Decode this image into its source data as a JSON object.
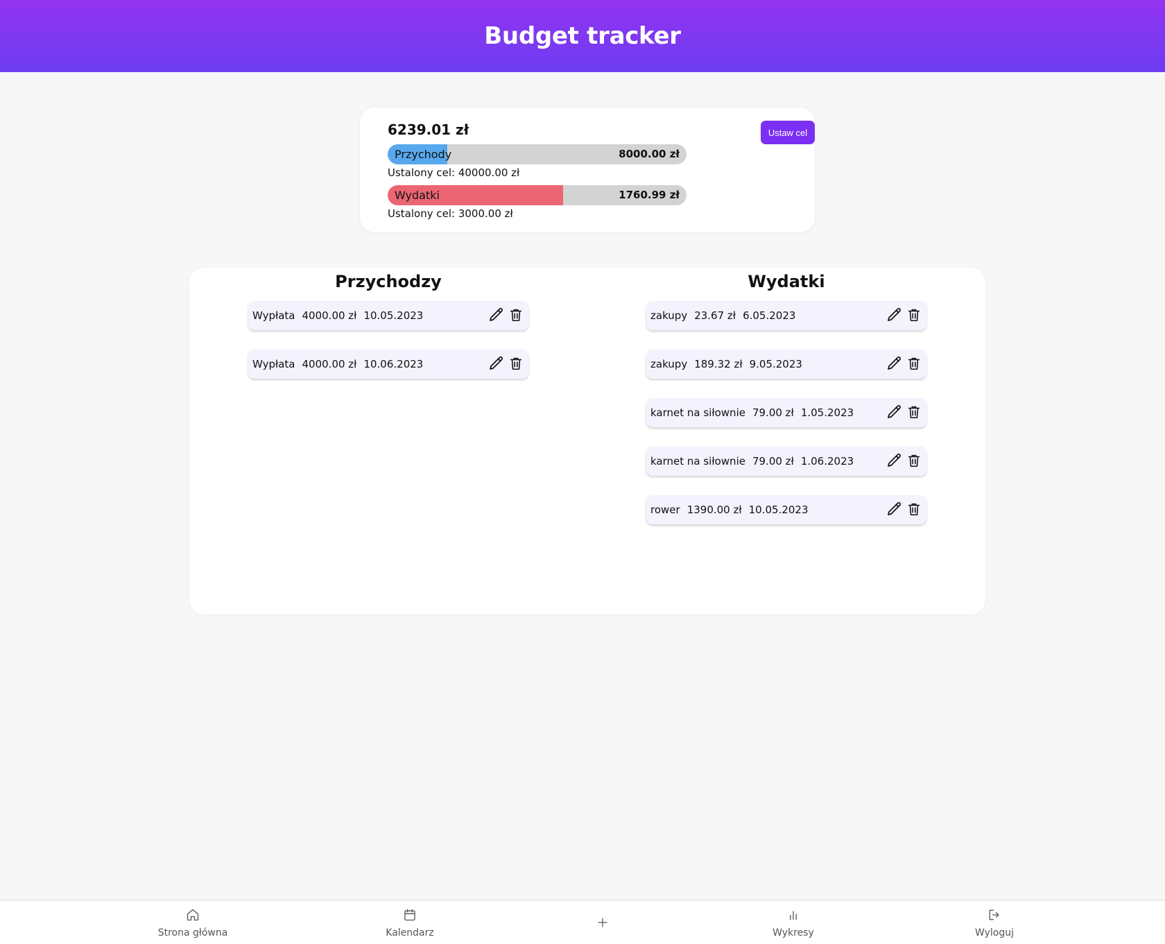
{
  "header": {
    "title": "Budget tracker"
  },
  "summary": {
    "balance": "6239.01 zł",
    "goal_button": "Ustaw cel",
    "income": {
      "label": "Przychody",
      "amount": "8000.00 zł",
      "goal": "Ustalony cel: 40000.00 zł",
      "progress_percent": 20,
      "color": "#58a8ee"
    },
    "expenses": {
      "label": "Wydatki",
      "amount": "1760.99 zł",
      "goal": "Ustalony cel: 3000.00 zł",
      "progress_percent": 58.7,
      "color": "#eb6672"
    }
  },
  "income_list": {
    "title": "Przychodzy",
    "items": [
      {
        "name": "Wypłata",
        "amount": "4000.00 zł",
        "date": "10.05.2023"
      },
      {
        "name": "Wypłata",
        "amount": "4000.00 zł",
        "date": "10.06.2023"
      }
    ]
  },
  "expense_list": {
    "title": "Wydatki",
    "items": [
      {
        "name": "zakupy",
        "amount": "23.67 zł",
        "date": "6.05.2023"
      },
      {
        "name": "zakupy",
        "amount": "189.32 zł",
        "date": "9.05.2023"
      },
      {
        "name": "karnet na siłownie",
        "amount": "79.00 zł",
        "date": "1.05.2023"
      },
      {
        "name": "karnet na siłownie",
        "amount": "79.00 zł",
        "date": "1.06.2023"
      },
      {
        "name": "rower",
        "amount": "1390.00 zł",
        "date": "10.05.2023"
      }
    ]
  },
  "navbar": {
    "items": [
      {
        "label": "Strona główna",
        "icon": "home-icon"
      },
      {
        "label": "Kalendarz",
        "icon": "calendar-icon"
      },
      {
        "label": "",
        "icon": "plus-icon"
      },
      {
        "label": "Wykresy",
        "icon": "bar-chart-icon"
      },
      {
        "label": "Wyloguj",
        "icon": "logout-icon"
      }
    ]
  },
  "colors": {
    "accent": "#7b2ff2",
    "header_top": "#9333f0",
    "header_bottom": "#6d3df2"
  }
}
